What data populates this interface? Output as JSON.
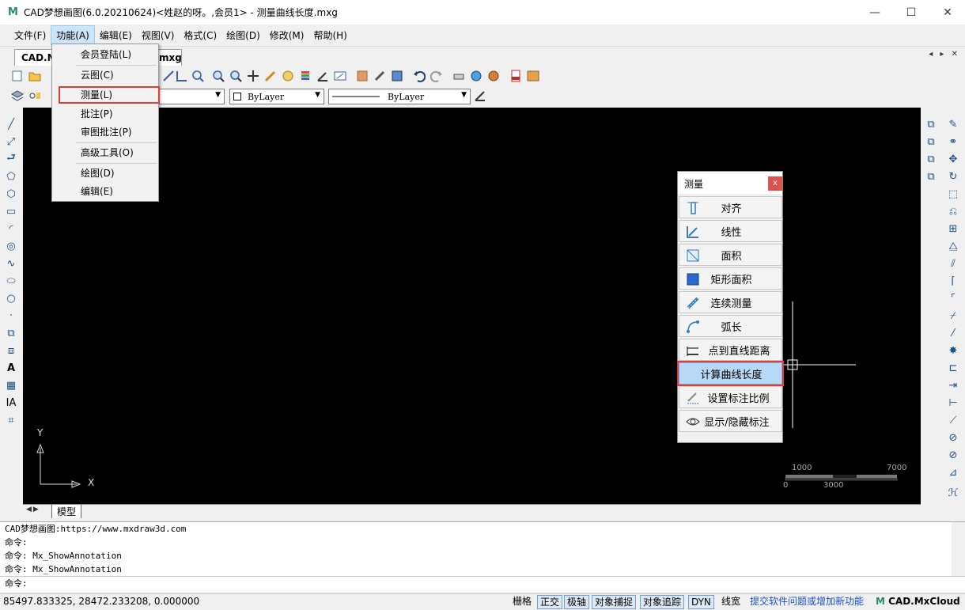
{
  "window": {
    "title": "CAD梦想画图(6.0.20210624)<姓赵的呀。,会员1> - 测量曲线长度.mxg",
    "minimize": "—",
    "maximize": "☐",
    "close": "✕"
  },
  "menubar": {
    "items": [
      "文件(F)",
      "功能(A)",
      "编辑(E)",
      "视图(V)",
      "格式(C)",
      "绘图(D)",
      "修改(M)",
      "帮助(H)"
    ],
    "active_index": 1
  },
  "tabs": {
    "tab1": "CAD.M",
    "tab2": "mxg",
    "nav": "◂ ▸ ✕"
  },
  "toolbar2": {
    "color_combo": "ByLayer",
    "linetype_combo": "ByLayer"
  },
  "dropdown": {
    "items": [
      "会员登陆(L)",
      "云图(C)",
      "测量(L)",
      "批注(P)",
      "审图批注(P)",
      "高级工具(O)",
      "绘图(D)",
      "编辑(E)"
    ],
    "highlighted_index": 2
  },
  "measure_panel": {
    "title": "测量",
    "close": "x",
    "buttons": [
      "对齐",
      "线性",
      "面积",
      "矩形面积",
      "连续测量",
      "弧长",
      "点到直线距离",
      "计算曲线长度",
      "设置标注比例",
      "显示/隐藏标注"
    ],
    "selected_index": 7
  },
  "canvas": {
    "axis_x": "X",
    "axis_y": "Y",
    "scale_top_left": "1000",
    "scale_top_right": "7000",
    "scale_bottom_left": "0",
    "scale_bottom_mid": "3000"
  },
  "model_tab": "模型",
  "command": {
    "lines": [
      "CAD梦想画图:https://www.mxdraw3d.com",
      "命令:",
      "命令: Mx_ShowAnnotation",
      "命令: Mx_ShowAnnotation"
    ],
    "prompt": "命令:"
  },
  "status": {
    "coords": "85497.833325,  28472.233208,  0.000000",
    "grid": "栅格",
    "ortho": "正交",
    "polar": "极轴",
    "osnap": "对象捕捉",
    "otrack": "对象追踪",
    "dyn": "DYN",
    "lineweight": "线宽",
    "feedback": "提交软件问题或增加新功能",
    "brand": "CAD.MxCloud"
  },
  "colors": {
    "canvas_bg": "#000000",
    "highlight_border": "#e03c3c",
    "selected_bg": "#b8d8f5",
    "link": "#1a4fd6"
  }
}
